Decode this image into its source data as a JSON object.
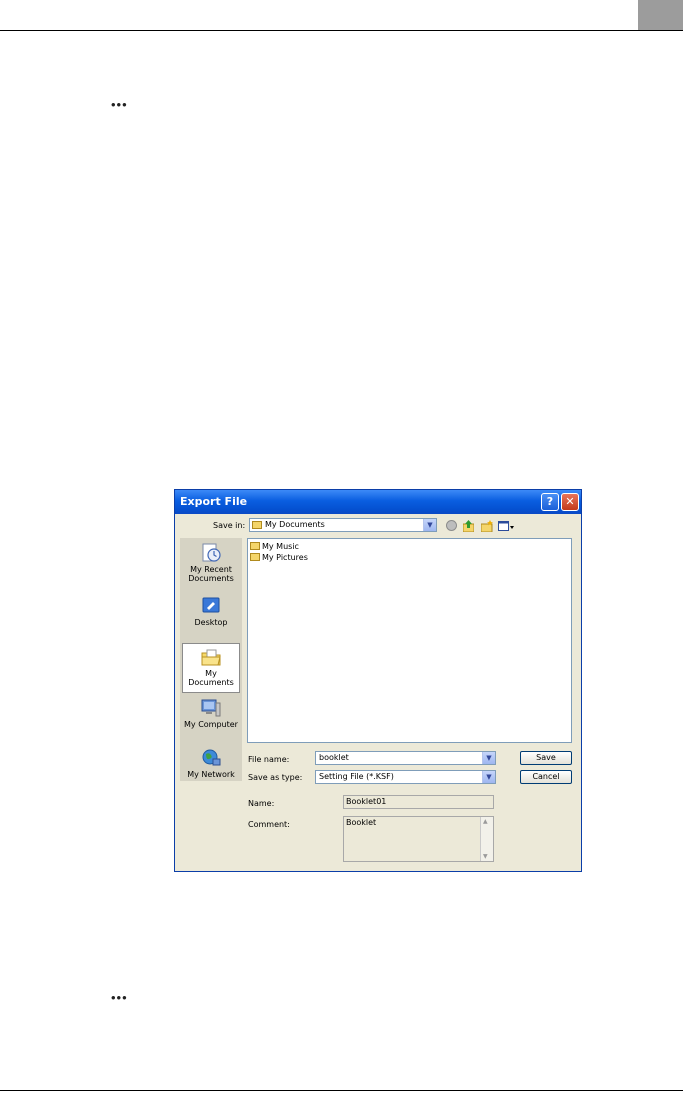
{
  "dialog": {
    "title": "Export File",
    "save_in_label": "Save in:",
    "save_in_value": "My Documents",
    "places": [
      {
        "label": "My Recent Documents",
        "icon": "recent-documents-icon"
      },
      {
        "label": "Desktop",
        "icon": "desktop-icon"
      },
      {
        "label": "My Documents",
        "icon": "my-documents-icon"
      },
      {
        "label": "My Computer",
        "icon": "my-computer-icon"
      },
      {
        "label": "My Network",
        "icon": "my-network-icon"
      }
    ],
    "files": [
      {
        "name": "My Music"
      },
      {
        "name": "My Pictures"
      }
    ],
    "file_name_label": "File name:",
    "file_name_value": "booklet",
    "save_as_type_label": "Save as type:",
    "save_as_type_value": "Setting File (*.KSF)",
    "save_button": "Save",
    "cancel_button": "Cancel",
    "name_label": "Name:",
    "name_value": "Booklet01",
    "comment_label": "Comment:",
    "comment_value": "Booklet"
  },
  "colors": {
    "titlebar": "#0a5ee0",
    "dialog_bg": "#ece9d8",
    "page_tab": "#9c9c9c"
  }
}
